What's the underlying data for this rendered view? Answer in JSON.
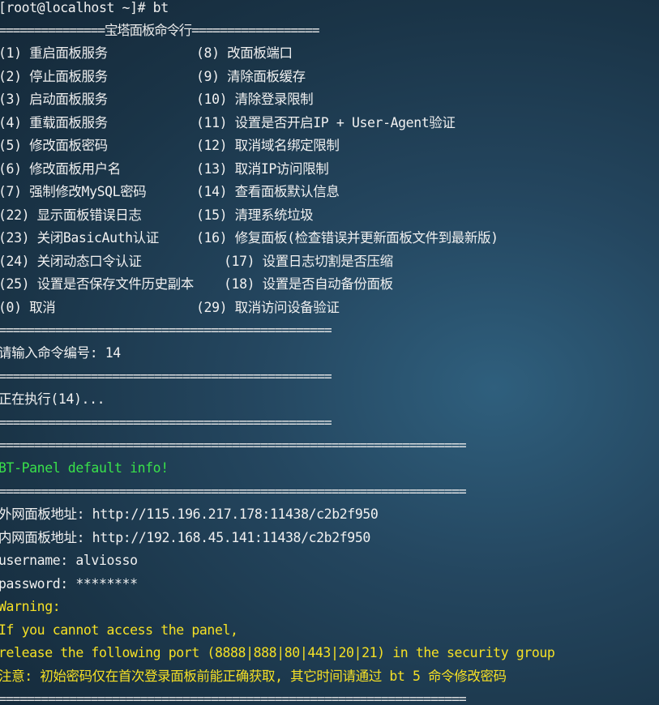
{
  "terminal": {
    "prompt_line": "[root@localhost ~]# bt",
    "menu_header": "===============宝塔面板命令行==================",
    "menu": [
      {
        "left": "(1) 重启面板服务",
        "right": "(8) 改面板端口"
      },
      {
        "left": "(2) 停止面板服务",
        "right": "(9) 清除面板缓存"
      },
      {
        "left": "(3) 启动面板服务",
        "right": "(10) 清除登录限制"
      },
      {
        "left": "(4) 重载面板服务",
        "right": "(11) 设置是否开启IP + User-Agent验证"
      },
      {
        "left": "(5) 修改面板密码",
        "right": "(12) 取消域名绑定限制"
      },
      {
        "left": "(6) 修改面板用户名",
        "right": "(13) 取消IP访问限制"
      },
      {
        "left": "(7) 强制修改MySQL密码",
        "right": "(14) 查看面板默认信息"
      },
      {
        "left": "(22) 显示面板错误日志",
        "right": "(15) 清理系统垃圾"
      },
      {
        "left": "(23) 关闭BasicAuth认证",
        "right": "(16) 修复面板(检查错误并更新面板文件到最新版)"
      },
      {
        "left": "(24) 关闭动态口令认证",
        "right": "(17) 设置日志切割是否压缩"
      },
      {
        "left": "(25) 设置是否保存文件历史副本",
        "right": "(18) 设置是否自动备份面板"
      },
      {
        "left": "(0) 取消",
        "right": "(29) 取消访问设备验证"
      }
    ],
    "separator_short": "===============================================",
    "input_prompt": "请输入命令编号: 14",
    "executing": "正在执行(14)...",
    "separator_long": "==================================================================",
    "info_title": "BT-Panel default info!",
    "external_address_label": "外网面板地址: ",
    "external_address": "http://115.196.217.178:11438/c2b2f950",
    "internal_address_label": "内网面板地址: ",
    "internal_address": "http://192.168.45.141:11438/c2b2f950",
    "username_label": "username: ",
    "username": "alviosso",
    "password_label": "password: ",
    "password": "********",
    "warning_title": "Warning:",
    "warning_line1": "If you cannot access the panel,",
    "warning_line2": "release the following port (8888|888|80|443|20|21) in the security group",
    "notice": "注意: 初始密码仅在首次登录面板前能正确获取, 其它时间请通过 bt 5 命令修改密码"
  },
  "colors": {
    "text": "#f0f0f0",
    "info_title": "#39e14a",
    "warning": "#f5e025"
  }
}
